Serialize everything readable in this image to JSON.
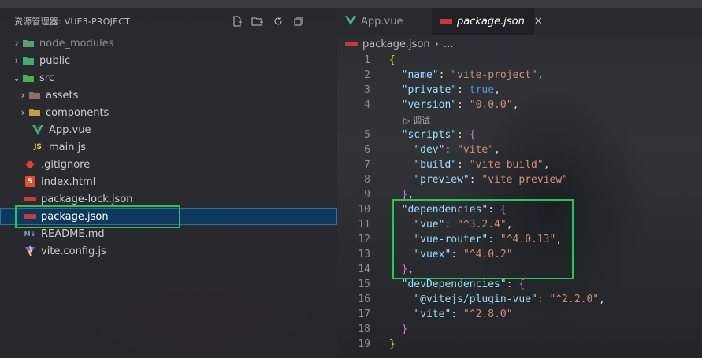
{
  "sidebar": {
    "title": "资源管理器: VUE3-PROJECT",
    "items": [
      {
        "label": "node_modules",
        "icon": "folder-node-icon"
      },
      {
        "label": "public",
        "icon": "folder-public-icon"
      },
      {
        "label": "src",
        "icon": "folder-src-icon"
      },
      {
        "label": "assets",
        "icon": "folder-assets-icon"
      },
      {
        "label": "components",
        "icon": "folder-components-icon"
      },
      {
        "label": "App.vue",
        "icon": "vue-icon"
      },
      {
        "label": "main.js",
        "icon": "js-icon"
      },
      {
        "label": ".gitignore",
        "icon": "git-icon"
      },
      {
        "label": "index.html",
        "icon": "html-icon"
      },
      {
        "label": "package-lock.json",
        "icon": "npm-icon"
      },
      {
        "label": "package.json",
        "icon": "npm-icon"
      },
      {
        "label": "README.md",
        "icon": "markdown-icon"
      },
      {
        "label": "vite.config.js",
        "icon": "vite-icon"
      }
    ],
    "file_icon_text": {
      "js": "JS",
      "html": "5",
      "md": "M↓"
    }
  },
  "editor": {
    "tabs": [
      {
        "label": "App.vue",
        "active": false
      },
      {
        "label": "package.json",
        "active": true
      }
    ],
    "breadcrumb": {
      "file": "package.json",
      "rest": "…"
    },
    "codelens": "▷ 调试",
    "lines": {
      "n1": "1",
      "n2": "2",
      "n3": "3",
      "n4": "4",
      "n5": "5",
      "n6": "6",
      "n7": "7",
      "n8": "8",
      "n9": "9",
      "n10": "10",
      "n11": "11",
      "n12": "12",
      "n13": "13",
      "n14": "14",
      "n15": "15",
      "n16": "16",
      "n17": "17",
      "n18": "18",
      "n19": "19"
    },
    "code": {
      "name_key": "\"name\"",
      "name_val": "\"vite-project\"",
      "private_key": "\"private\"",
      "private_val": "true",
      "version_key": "\"version\"",
      "version_val": "\"0.0.0\"",
      "scripts_key": "\"scripts\"",
      "dev_key": "\"dev\"",
      "dev_val": "\"vite\"",
      "build_key": "\"build\"",
      "build_val": "\"vite build\"",
      "preview_key": "\"preview\"",
      "preview_val": "\"vite preview\"",
      "deps_key": "\"dependencies\"",
      "vue_key": "\"vue\"",
      "vue_val": "\"^3.2.4\"",
      "router_key": "\"vue-router\"",
      "router_val": "\"^4.0.13\"",
      "vuex_key": "\"vuex\"",
      "vuex_val": "\"^4.0.2\"",
      "devdeps_key": "\"devDependencies\"",
      "plugin_key": "\"@vitejs/plugin-vue\"",
      "plugin_val": "\"^2.2.0\"",
      "vite_key": "\"vite\"",
      "vite_val": "\"^2.8.0\""
    }
  },
  "colors": {
    "highlight": "#22c55e",
    "selection": "#0d3a5c"
  }
}
